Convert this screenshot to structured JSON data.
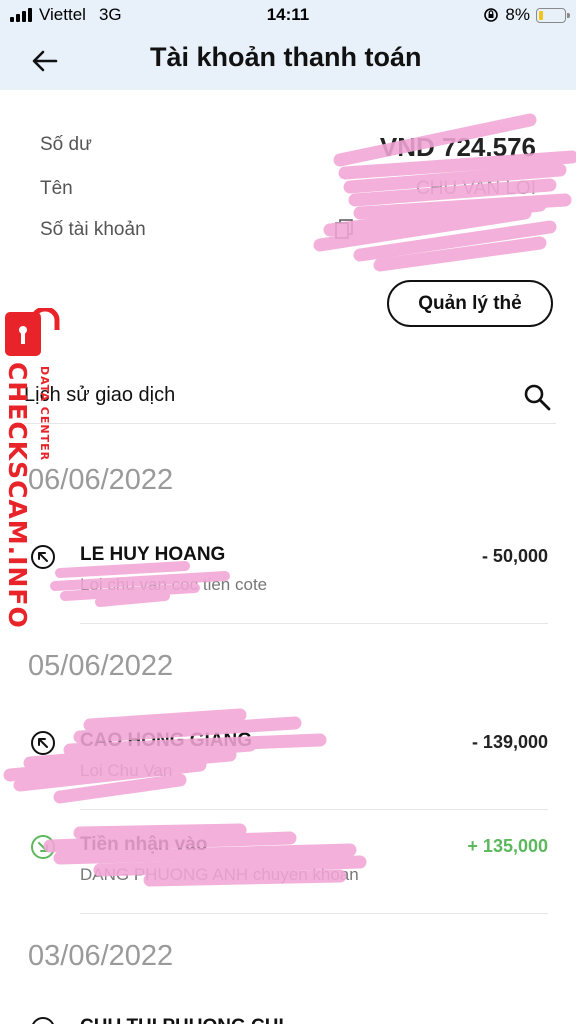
{
  "status_bar": {
    "carrier": "Viettel",
    "network": "3G",
    "time": "14:11",
    "battery": "8%",
    "battery_level": 0.08
  },
  "nav": {
    "title": "Tài khoản thanh toán",
    "back_icon": "arrow-left-icon"
  },
  "account": {
    "balance_label": "Số dư",
    "balance_value": "VND 724.576",
    "name_label": "Tên",
    "name_value": "CHU VAN LOI",
    "account_number_label": "Số tài khoản"
  },
  "manage_card_label": "Quản lý thẻ",
  "history": {
    "title": "Lịch sử giao dịch",
    "search_icon": "search-icon",
    "groups": [
      {
        "date": "06/06/2022",
        "transactions": [
          {
            "name": "LE HUY HOANG",
            "description": "Loi chu van coc tien cote",
            "amount": "- 50,000",
            "direction": "out"
          }
        ]
      },
      {
        "date": "05/06/2022",
        "transactions": [
          {
            "name": "CAO HONG GIANG",
            "description": "Loi Chu Van",
            "amount": "- 139,000",
            "direction": "out"
          },
          {
            "name": "Tiền nhận vào",
            "description": "DANG PHUONG ANH chuyen khoan",
            "amount": "+ 135,000",
            "direction": "in"
          }
        ]
      },
      {
        "date": "03/06/2022",
        "transactions": [
          {
            "name": "CHU THI PHUONG CHI",
            "description": "",
            "amount": "",
            "direction": "out"
          }
        ]
      }
    ]
  },
  "watermark": {
    "brand": "CHECKSCAM.INFO",
    "sub": "DATA CENTER",
    "color": "#e8242a"
  },
  "colors": {
    "header_bg": "#e8f1fa",
    "incoming": "#5cb85c",
    "scribble": "#f2a6d6"
  }
}
